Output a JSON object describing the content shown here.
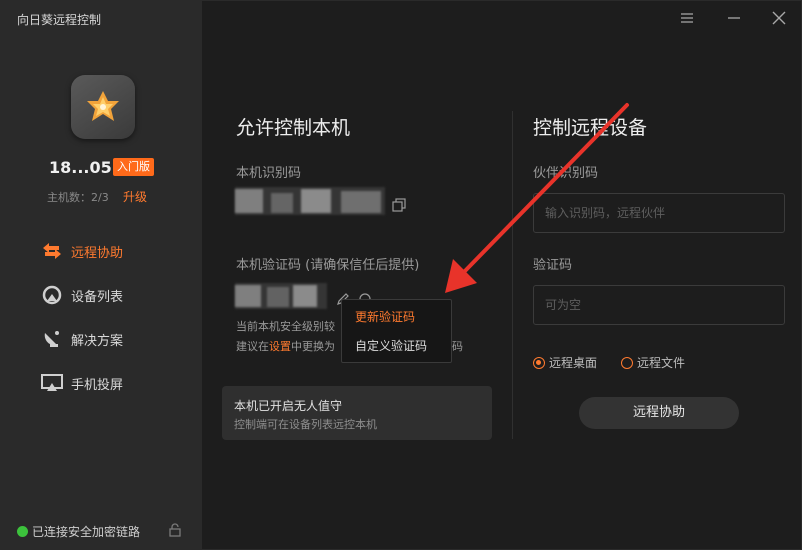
{
  "app": {
    "title": "向日葵远程控制"
  },
  "sidebar": {
    "device_id": "18...05",
    "badge": "入门版",
    "host_count": "主机数：2/3",
    "upgrade": "升级",
    "nav": [
      {
        "label": "远程协助",
        "icon": "remote-assist-icon"
      },
      {
        "label": "设备列表",
        "icon": "device-list-icon"
      },
      {
        "label": "解决方案",
        "icon": "solutions-icon"
      },
      {
        "label": "手机投屏",
        "icon": "screen-cast-icon"
      }
    ],
    "status": "已连接安全加密链路"
  },
  "allow": {
    "title": "允许控制本机",
    "id_label": "本机识别码",
    "code_label": "本机验证码 (请确保信任后提供)",
    "note_line1_a": "当前本机",
    "note_line1_b": "安全级别较",
    "note_line2_a": "建议在",
    "note_line2_link": "设置",
    "note_line2_b": "中更换为",
    "note_line2_c": "码",
    "unattended_title": "本机已开启无人值守",
    "unattended_desc": "控制端可在设备列表远控本机"
  },
  "menu": {
    "refresh": "更新验证码",
    "custom": "自定义验证码"
  },
  "control": {
    "title": "控制远程设备",
    "partner_label": "伙伴识别码",
    "partner_placeholder": "输入识别码，远程伙伴",
    "code_label": "验证码",
    "code_placeholder": "可为空",
    "option_desktop": "远程桌面",
    "option_file": "远程文件",
    "button": "远程协助"
  },
  "colors": {
    "accent": "#ff7a2f",
    "status_ok": "#3cc23c",
    "arrow": "#e8332a"
  }
}
